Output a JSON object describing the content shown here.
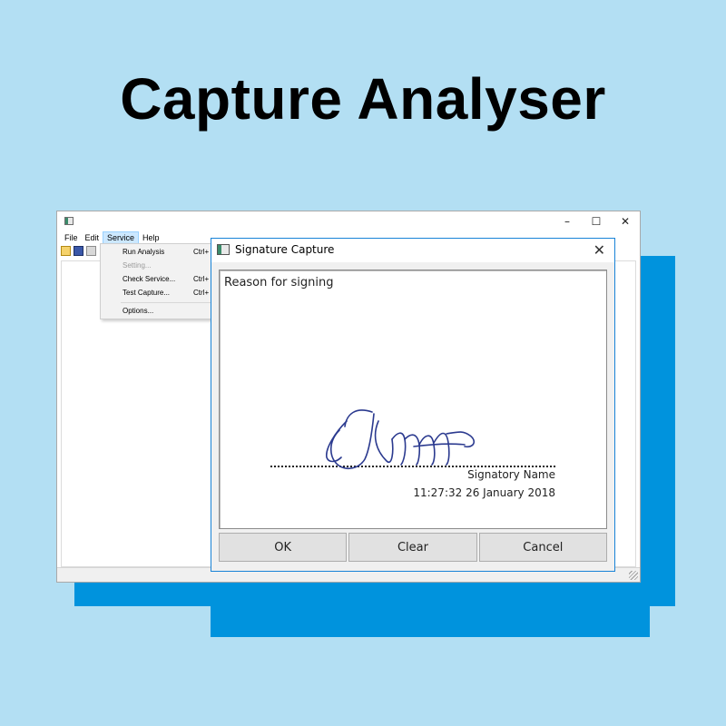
{
  "hero": {
    "title": "Capture Analyser"
  },
  "main_window": {
    "controls": {
      "minimize": "–",
      "maximize": "☐",
      "close": "✕"
    },
    "menu": [
      "File",
      "Edit",
      "Service",
      "Help"
    ],
    "active_menu": "Service",
    "dropdown": [
      {
        "label": "Run Analysis",
        "shortcut": "Ctrl+",
        "disabled": false
      },
      {
        "label": "Setting...",
        "shortcut": "",
        "disabled": true
      },
      {
        "label": "Check Service...",
        "shortcut": "Ctrl+",
        "disabled": false
      },
      {
        "label": "Test Capture...",
        "shortcut": "Ctrl+",
        "disabled": false
      },
      {
        "label": "Options...",
        "shortcut": "",
        "disabled": false
      }
    ]
  },
  "dialog": {
    "title": "Signature Capture",
    "close": "✕",
    "reason": "Reason for signing",
    "signatory": "Signatory Name",
    "timestamp": "11:27:32 26 January 2018",
    "buttons": {
      "ok": "OK",
      "clear": "Clear",
      "cancel": "Cancel"
    }
  },
  "colors": {
    "background": "#b3dff3",
    "accent_blue": "#0093dd",
    "ink": "#2b3a8f",
    "dialog_border": "#1883d7"
  }
}
